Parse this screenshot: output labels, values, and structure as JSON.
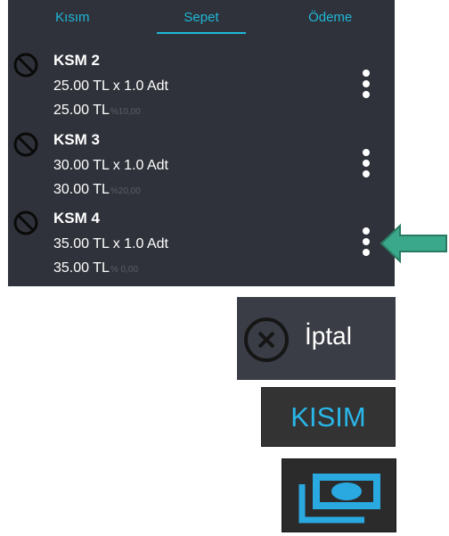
{
  "tabs": [
    {
      "label": "Kısım"
    },
    {
      "label": "Sepet"
    },
    {
      "label": "Ödeme"
    }
  ],
  "basket": {
    "items": [
      {
        "name": "KSM 2",
        "qty_line": "25.00 TL x 1.0 Adt",
        "total": "25.00 TL",
        "tax": "%10,00"
      },
      {
        "name": "KSM 3",
        "qty_line": "30.00 TL x 1.0 Adt",
        "total": "30.00 TL",
        "tax": "%20,00"
      },
      {
        "name": "KSM 4",
        "qty_line": "35.00 TL x 1.0 Adt",
        "total": "35.00 TL",
        "tax": "% 0,00"
      }
    ]
  },
  "legend": {
    "iptal_label": "İptal",
    "kisim_label": "KISIM",
    "pay_icon": "payment-icon"
  },
  "colors": {
    "panel_bg": "#2f323a",
    "accent": "#1fb7d8",
    "kisim_text": "#29b6e8",
    "arrow": "#3aa88a"
  }
}
